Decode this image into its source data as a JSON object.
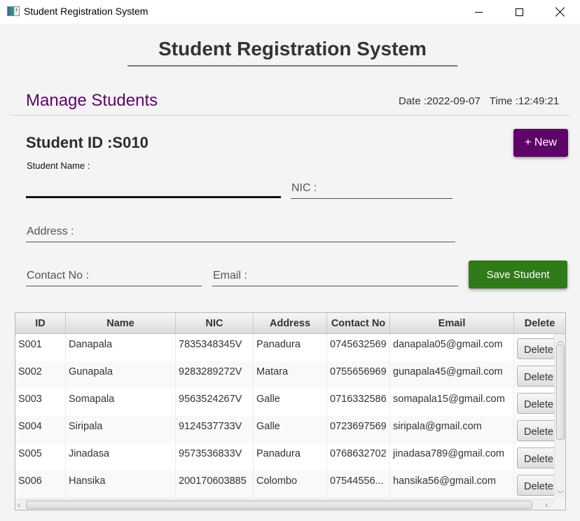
{
  "window": {
    "title": "Student Registration System",
    "icon": "java-app-icon",
    "controls": [
      "minimize",
      "maximize",
      "close"
    ]
  },
  "header": {
    "title": "Student Registration System"
  },
  "section": {
    "title": "Manage Students",
    "date_label": "Date :2022-09-07",
    "time_label": "Time :12:49:21",
    "title_color": "#5c0766"
  },
  "form": {
    "student_id_label": "Student ID :S010",
    "new_button": "+ New",
    "new_button_color": "#5e0367",
    "student_name": {
      "label": "Student Name :",
      "value": ""
    },
    "nic": {
      "placeholder": "NIC :",
      "value": ""
    },
    "address": {
      "placeholder": "Address :",
      "value": ""
    },
    "contact": {
      "placeholder": "Contact No :",
      "value": ""
    },
    "email": {
      "placeholder": "Email :",
      "value": ""
    },
    "save_button": "Save Student",
    "save_button_color": "#2f7a19"
  },
  "table": {
    "columns": [
      "ID",
      "Name",
      "NIC",
      "Address",
      "Contact No",
      "Email",
      "Delete"
    ],
    "delete_label": "Delete",
    "rows": [
      [
        "S001",
        "Danapala",
        "7835348345V",
        "Panadura",
        "0745632569",
        "danapala05@gmail.com"
      ],
      [
        "S002",
        "Gunapala",
        "9283289272V",
        "Matara",
        "0755656969",
        "gunapala45@gmail.com"
      ],
      [
        "S003",
        "Somapala",
        "9563524267V",
        "Galle",
        "0716332586",
        "somapala15@gmail.com"
      ],
      [
        "S004",
        "Siripala",
        "9124537733V",
        "Galle",
        "0723697569",
        "siripala@gmail.com"
      ],
      [
        "S005",
        "Jinadasa",
        "9573536833V",
        "Panadura",
        "0768632702",
        "jinadasa789@gmail.com"
      ],
      [
        "S006",
        "Hansika",
        "200170603885",
        "Colombo",
        "07544556...",
        "hansika56@gmail.com"
      ]
    ]
  }
}
